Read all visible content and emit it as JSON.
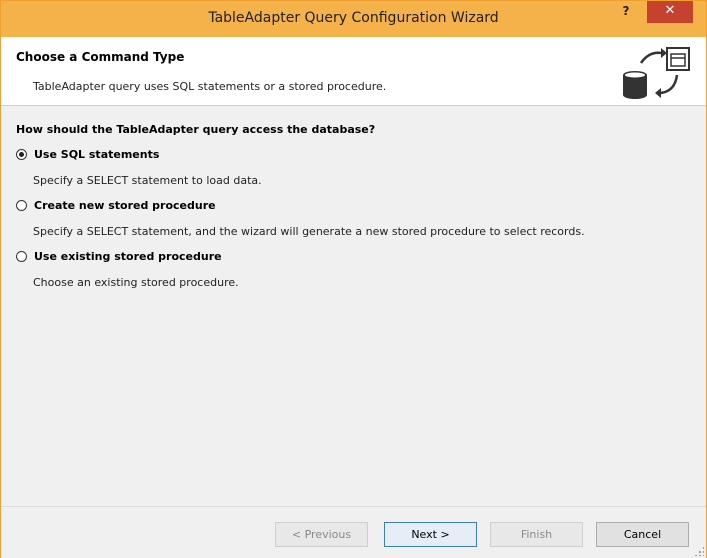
{
  "window": {
    "title": "TableAdapter Query Configuration Wizard",
    "help_label": "?",
    "close_label": "✕"
  },
  "header": {
    "title": "Choose a Command Type",
    "subtitle": "TableAdapter query uses SQL statements or a stored procedure."
  },
  "main": {
    "question": "How should the TableAdapter query access the database?",
    "options": [
      {
        "label": "Use SQL statements",
        "description": "Specify a SELECT statement to load data.",
        "selected": true
      },
      {
        "label": "Create new stored procedure",
        "description": "Specify a SELECT statement, and the wizard will generate a new stored procedure to select records.",
        "selected": false
      },
      {
        "label": "Use existing stored procedure",
        "description": "Choose an existing stored procedure.",
        "selected": false
      }
    ]
  },
  "footer": {
    "previous_label": "< Previous",
    "next_label": "Next >",
    "finish_label": "Finish",
    "cancel_label": "Cancel"
  },
  "colors": {
    "titlebar": "#f5b14a",
    "close_button": "#c7412f",
    "header_background": "#ffffff",
    "body_background": "#f0f0f0"
  },
  "icons": {
    "header": "database-command-icon",
    "help": "help-icon",
    "close": "close-icon",
    "resize": "resize-grip-icon"
  }
}
